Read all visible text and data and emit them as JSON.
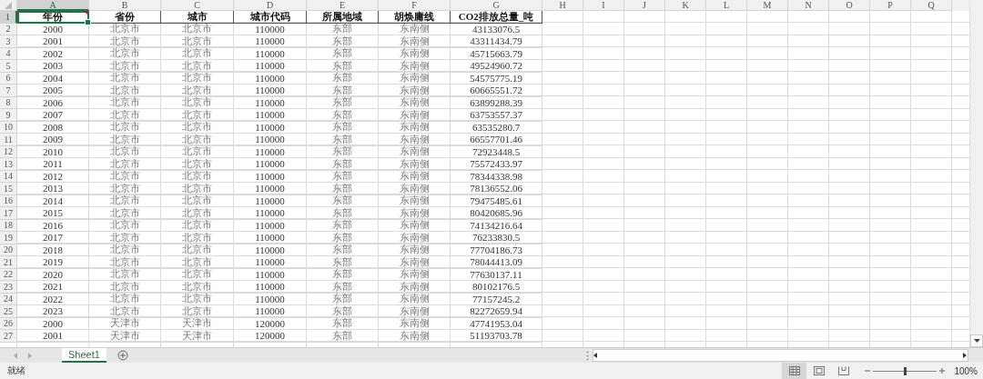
{
  "columns": [
    {
      "label": "A",
      "selected": true
    },
    {
      "label": "B",
      "selected": false
    },
    {
      "label": "C",
      "selected": false
    },
    {
      "label": "D",
      "selected": false
    },
    {
      "label": "E",
      "selected": false
    },
    {
      "label": "F",
      "selected": false
    },
    {
      "label": "G",
      "selected": false
    },
    {
      "label": "H",
      "selected": false
    },
    {
      "label": "I",
      "selected": false
    },
    {
      "label": "J",
      "selected": false
    },
    {
      "label": "K",
      "selected": false
    },
    {
      "label": "L",
      "selected": false
    },
    {
      "label": "M",
      "selected": false
    },
    {
      "label": "N",
      "selected": false
    },
    {
      "label": "O",
      "selected": false
    },
    {
      "label": "P",
      "selected": false
    },
    {
      "label": "Q",
      "selected": false
    }
  ],
  "rows": [
    {
      "number": "1",
      "selected": true,
      "comment": true,
      "kind": "header",
      "cells": [
        "年份",
        "省份",
        "城市",
        "城市代码",
        "所属地域",
        "胡焕庸线",
        "CO2排放总量_吨"
      ]
    },
    {
      "number": "2",
      "selected": false,
      "comment": false,
      "kind": "data",
      "cells": [
        "2000",
        "北京市",
        "北京市",
        "110000",
        "东部",
        "东南侧",
        "43133076.5"
      ]
    },
    {
      "number": "3",
      "selected": false,
      "comment": false,
      "kind": "data",
      "cells": [
        "2001",
        "北京市",
        "北京市",
        "110000",
        "东部",
        "东南侧",
        "43311434.79"
      ]
    },
    {
      "number": "4",
      "selected": false,
      "comment": false,
      "kind": "data",
      "cells": [
        "2002",
        "北京市",
        "北京市",
        "110000",
        "东部",
        "东南侧",
        "45715663.79"
      ]
    },
    {
      "number": "5",
      "selected": false,
      "comment": false,
      "kind": "data",
      "cells": [
        "2003",
        "北京市",
        "北京市",
        "110000",
        "东部",
        "东南侧",
        "49524960.72"
      ]
    },
    {
      "number": "6",
      "selected": false,
      "comment": false,
      "kind": "data",
      "cells": [
        "2004",
        "北京市",
        "北京市",
        "110000",
        "东部",
        "东南侧",
        "54575775.19"
      ]
    },
    {
      "number": "7",
      "selected": false,
      "comment": false,
      "kind": "data",
      "cells": [
        "2005",
        "北京市",
        "北京市",
        "110000",
        "东部",
        "东南侧",
        "60665551.72"
      ]
    },
    {
      "number": "8",
      "selected": false,
      "comment": false,
      "kind": "data",
      "cells": [
        "2006",
        "北京市",
        "北京市",
        "110000",
        "东部",
        "东南侧",
        "63899288.39"
      ]
    },
    {
      "number": "9",
      "selected": false,
      "comment": false,
      "kind": "data",
      "cells": [
        "2007",
        "北京市",
        "北京市",
        "110000",
        "东部",
        "东南侧",
        "63753557.37"
      ]
    },
    {
      "number": "10",
      "selected": false,
      "comment": false,
      "kind": "data",
      "cells": [
        "2008",
        "北京市",
        "北京市",
        "110000",
        "东部",
        "东南侧",
        "63535280.7"
      ]
    },
    {
      "number": "11",
      "selected": false,
      "comment": false,
      "kind": "data",
      "cells": [
        "2009",
        "北京市",
        "北京市",
        "110000",
        "东部",
        "东南侧",
        "66557701.46"
      ]
    },
    {
      "number": "12",
      "selected": false,
      "comment": false,
      "kind": "data",
      "cells": [
        "2010",
        "北京市",
        "北京市",
        "110000",
        "东部",
        "东南侧",
        "72923448.5"
      ]
    },
    {
      "number": "13",
      "selected": false,
      "comment": false,
      "kind": "data",
      "cells": [
        "2011",
        "北京市",
        "北京市",
        "110000",
        "东部",
        "东南侧",
        "75572433.97"
      ]
    },
    {
      "number": "14",
      "selected": false,
      "comment": false,
      "kind": "data",
      "cells": [
        "2012",
        "北京市",
        "北京市",
        "110000",
        "东部",
        "东南侧",
        "78344338.98"
      ]
    },
    {
      "number": "15",
      "selected": false,
      "comment": false,
      "kind": "data",
      "cells": [
        "2013",
        "北京市",
        "北京市",
        "110000",
        "东部",
        "东南侧",
        "78136552.06"
      ]
    },
    {
      "number": "16",
      "selected": false,
      "comment": false,
      "kind": "data",
      "cells": [
        "2014",
        "北京市",
        "北京市",
        "110000",
        "东部",
        "东南侧",
        "79475485.61"
      ]
    },
    {
      "number": "17",
      "selected": false,
      "comment": false,
      "kind": "data",
      "cells": [
        "2015",
        "北京市",
        "北京市",
        "110000",
        "东部",
        "东南侧",
        "80420685.96"
      ]
    },
    {
      "number": "18",
      "selected": false,
      "comment": false,
      "kind": "data",
      "cells": [
        "2016",
        "北京市",
        "北京市",
        "110000",
        "东部",
        "东南侧",
        "74134216.64"
      ]
    },
    {
      "number": "19",
      "selected": false,
      "comment": false,
      "kind": "data",
      "cells": [
        "2017",
        "北京市",
        "北京市",
        "110000",
        "东部",
        "东南侧",
        "76233830.5"
      ]
    },
    {
      "number": "20",
      "selected": false,
      "comment": false,
      "kind": "data",
      "cells": [
        "2018",
        "北京市",
        "北京市",
        "110000",
        "东部",
        "东南侧",
        "77704186.73"
      ]
    },
    {
      "number": "21",
      "selected": false,
      "comment": false,
      "kind": "data",
      "cells": [
        "2019",
        "北京市",
        "北京市",
        "110000",
        "东部",
        "东南侧",
        "78044413.09"
      ]
    },
    {
      "number": "22",
      "selected": false,
      "comment": false,
      "kind": "data",
      "cells": [
        "2020",
        "北京市",
        "北京市",
        "110000",
        "东部",
        "东南侧",
        "77630137.11"
      ]
    },
    {
      "number": "23",
      "selected": false,
      "comment": false,
      "kind": "data",
      "cells": [
        "2021",
        "北京市",
        "北京市",
        "110000",
        "东部",
        "东南侧",
        "80102176.5"
      ]
    },
    {
      "number": "24",
      "selected": false,
      "comment": false,
      "kind": "data",
      "cells": [
        "2022",
        "北京市",
        "北京市",
        "110000",
        "东部",
        "东南侧",
        "77157245.2"
      ]
    },
    {
      "number": "25",
      "selected": false,
      "comment": false,
      "kind": "data",
      "cells": [
        "2023",
        "北京市",
        "北京市",
        "110000",
        "东部",
        "东南侧",
        "82272659.94"
      ]
    },
    {
      "number": "26",
      "selected": false,
      "comment": false,
      "kind": "data",
      "cells": [
        "2000",
        "天津市",
        "天津市",
        "120000",
        "东部",
        "东南侧",
        "47741953.04"
      ]
    },
    {
      "number": "27",
      "selected": false,
      "comment": false,
      "kind": "data",
      "cells": [
        "2001",
        "天津市",
        "天津市",
        "120000",
        "东部",
        "东南侧",
        "51193703.78"
      ]
    }
  ],
  "sheet_tabs": [
    {
      "label": "Sheet1",
      "selected": true
    }
  ],
  "status_bar": {
    "status": "就绪",
    "views": [
      {
        "kind": "normal",
        "selected": true
      },
      {
        "kind": "page-layout",
        "selected": false
      },
      {
        "kind": "page-break",
        "selected": false
      }
    ],
    "zoom": {
      "level": 0.5,
      "label": "100%"
    }
  }
}
